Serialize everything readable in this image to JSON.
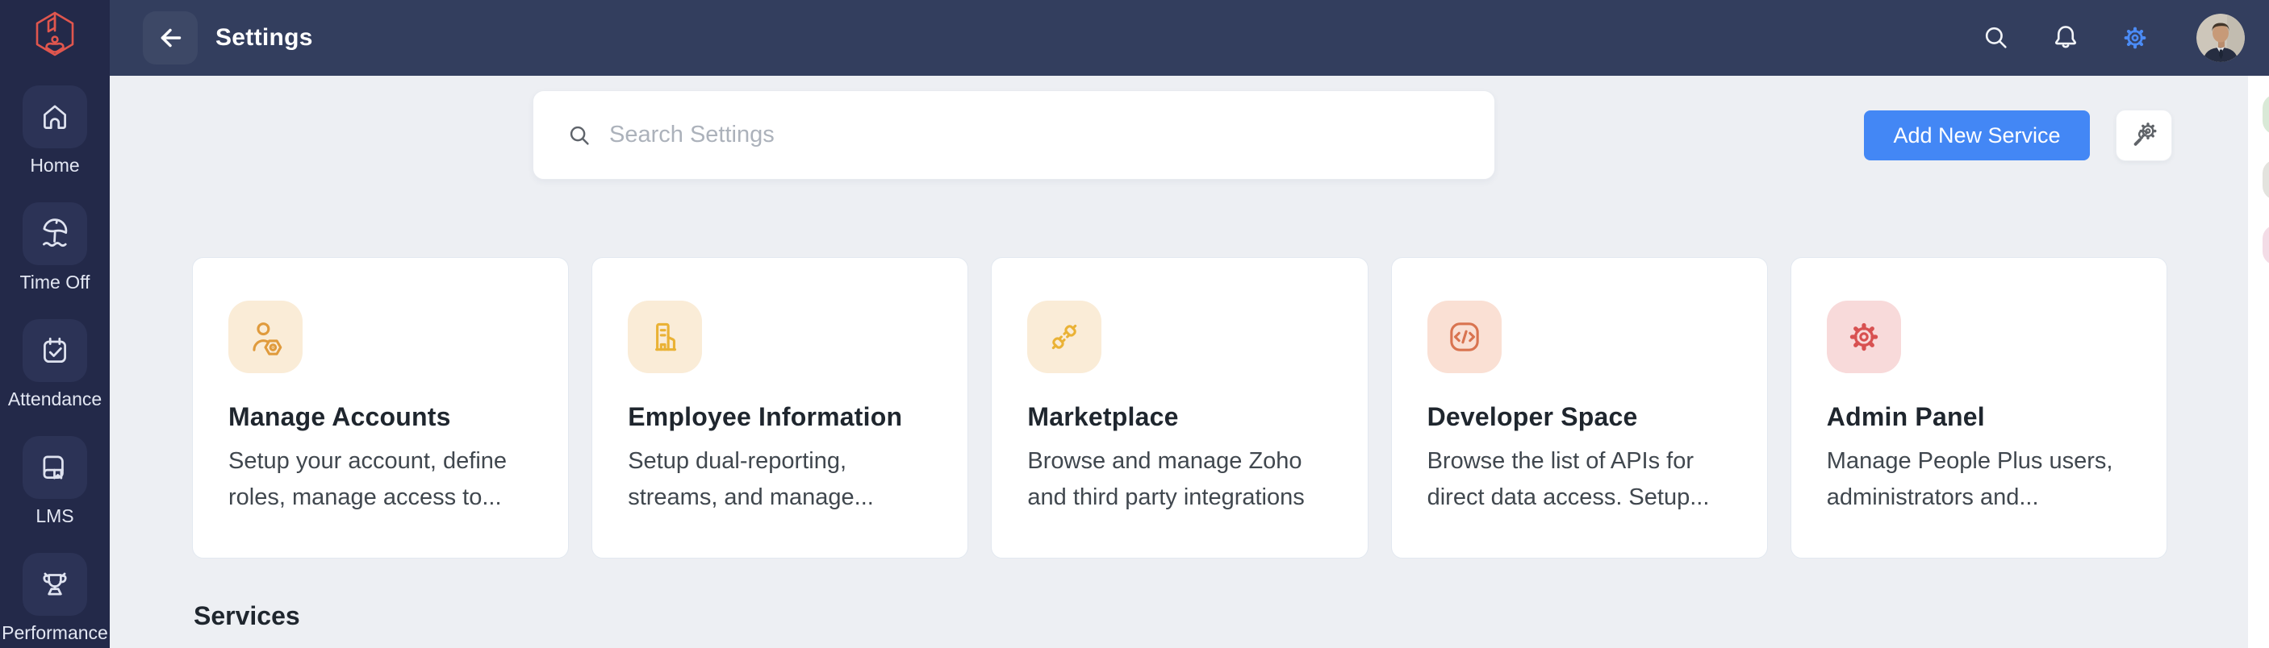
{
  "header": {
    "title": "Settings",
    "icons": [
      "back-arrow-icon",
      "search-icon",
      "notifications-bell-icon",
      "settings-gear-icon",
      "user-avatar"
    ]
  },
  "sidebar": {
    "logo_icon": "people-plus-logo-icon",
    "items": [
      {
        "label": "Home",
        "icon": "home-icon"
      },
      {
        "label": "Time Off",
        "icon": "beach-umbrella-icon"
      },
      {
        "label": "Attendance",
        "icon": "calendar-check-icon"
      },
      {
        "label": "LMS",
        "icon": "book-icon"
      },
      {
        "label": "Performance",
        "icon": "trophy-icon"
      }
    ]
  },
  "toolbar": {
    "search_placeholder": "Search Settings",
    "search_icon": "search-icon",
    "add_service_label": "Add New Service",
    "config_icon": "service-config-gear-wrench-icon"
  },
  "cards": [
    {
      "title": "Manage Accounts",
      "description": "Setup your account, define roles, manage access to...",
      "icon": "user-gear-icon",
      "icon_bg": "#faecd7",
      "icon_color": "#e09b3d"
    },
    {
      "title": "Employee Information",
      "description": "Setup dual-reporting, streams, and manage...",
      "icon": "building-icon",
      "icon_bg": "#faecd7",
      "icon_color": "#eab235"
    },
    {
      "title": "Marketplace",
      "description": "Browse and manage Zoho and third party integrations",
      "icon": "plug-connect-icon",
      "icon_bg": "#faecd7",
      "icon_color": "#eab235"
    },
    {
      "title": "Developer Space",
      "description": "Browse the list of APIs for direct data access. Setup...",
      "icon": "code-square-icon",
      "icon_bg": "#fae0d4",
      "icon_color": "#d97450"
    },
    {
      "title": "Admin Panel",
      "description": "Manage People Plus users, administrators and...",
      "icon": "admin-gear-icon",
      "icon_bg": "#f8dada",
      "icon_color": "#d85151"
    }
  ],
  "sections": {
    "services": "Services"
  },
  "colors": {
    "sidebar_bg": "#232949",
    "topbar_bg": "#333e5e",
    "page_bg": "#edeff3",
    "accent_blue": "#4387f5",
    "logo_red": "#e0564e",
    "active_gear_blue": "#4b8bf5"
  },
  "right_dock": {
    "pill_colors": [
      "#d9e9d7",
      "#e3e3de",
      "#f3dce6"
    ]
  }
}
